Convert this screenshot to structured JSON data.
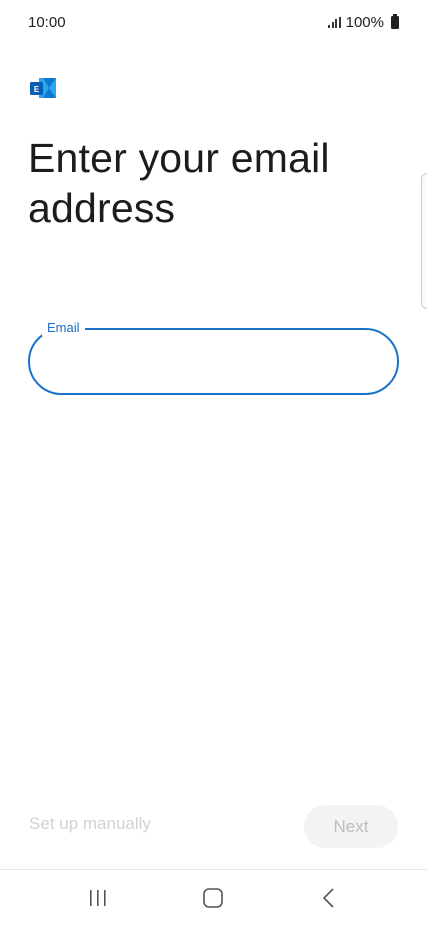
{
  "status_bar": {
    "time": "10:00",
    "battery_text": "100%",
    "icons": [
      "signal-icon",
      "battery-icon"
    ]
  },
  "app": {
    "logo_icon": "exchange-logo-icon",
    "logo_letter": "E",
    "brand_colors": [
      "#0a5db5",
      "#28a8ea",
      "#0f78d4"
    ]
  },
  "main": {
    "heading": "Enter your email address",
    "email_field": {
      "label": "Email",
      "value": "",
      "placeholder": "",
      "accent_color": "#1a73c7"
    }
  },
  "actions": {
    "setup_manual_label": "Set up manually",
    "next_label": "Next"
  },
  "nav_bar": {
    "icons": [
      "recent-apps-icon",
      "home-icon",
      "back-icon"
    ]
  }
}
